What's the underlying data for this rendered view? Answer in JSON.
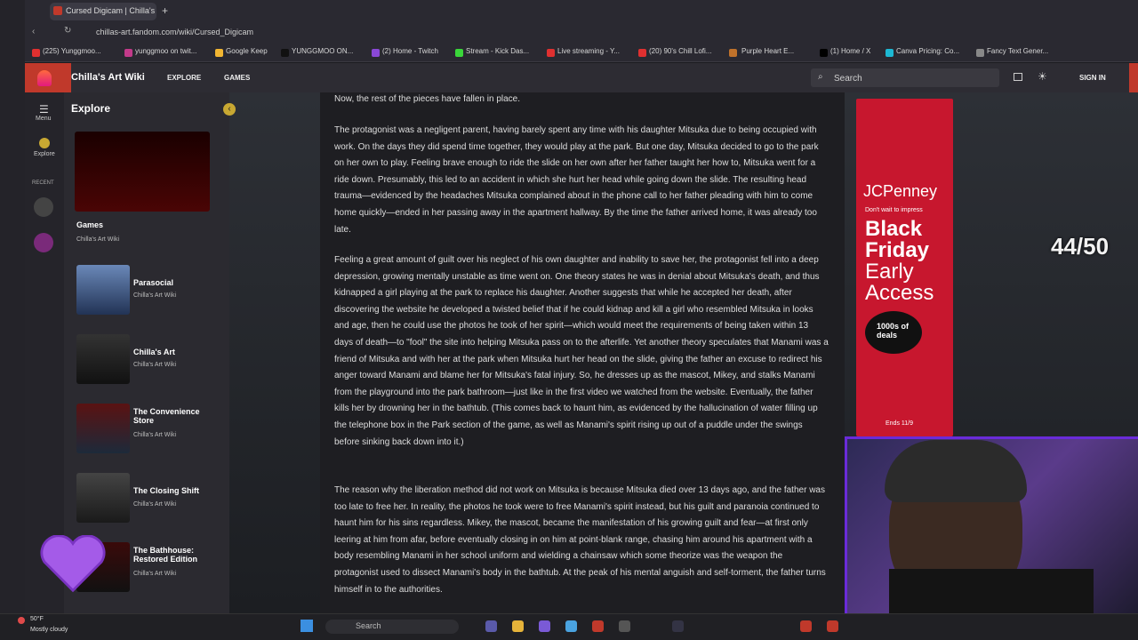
{
  "browser": {
    "tab_title": "Cursed Digicam | Chilla's",
    "url": "chillas-art.fandom.com/wiki/Cursed_Digicam",
    "bookmarks": [
      "(225) Yunggmoo...",
      "yunggmoo on twit...",
      "Google Keep",
      "YUNGGMOO ON...",
      "(2) Home - Twitch",
      "Stream - Kick Das...",
      "Live streaming - Y...",
      "(20) 90's Chill Lofi...",
      "Purple Heart E...",
      "(1) Home / X",
      "Canva Pricing: Co...",
      "Fancy Text Gener..."
    ]
  },
  "header": {
    "wiki_name": "Chilla's Art Wiki",
    "nav": [
      "EXPLORE",
      "GAMES"
    ],
    "search_label": "Search",
    "sign_in": "SIGN IN"
  },
  "rail": {
    "menu": "Menu",
    "explore": "Explore",
    "recent": "RECENT"
  },
  "explore": {
    "title": "Explore",
    "cards": [
      {
        "title": "Games",
        "sub": "Chilla's Art Wiki"
      },
      {
        "title": "Parasocial",
        "sub": "Chilla's Art Wiki"
      },
      {
        "title": "Chilla's Art",
        "sub": "Chilla's Art Wiki"
      },
      {
        "title": "The Convenience Store",
        "sub": "Chilla's Art Wiki"
      },
      {
        "title": "The Closing Shift",
        "sub": "Chilla's Art Wiki"
      },
      {
        "title": "The Bathhouse: Restored Edition",
        "sub": "Chilla's Art Wiki"
      }
    ]
  },
  "article": {
    "p0": "Now, the rest of the pieces have fallen in place.",
    "p1": "The protagonist was a negligent parent, having barely spent any time with his daughter Mitsuka due to being occupied with work. On the days they did spend time together, they would play at the park. But one day, Mitsuka decided to go to the park on her own to play. Feeling brave enough to ride the slide on her own after her father taught her how to, Mitsuka went for a ride down. Presumably, this led to an accident in which she hurt her head while going down the slide. The resulting head trauma—evidenced by the headaches Mitsuka complained about in the phone call to her father pleading with him to come home quickly—ended in her passing away in the apartment hallway. By the time the father arrived home, it was already too late.",
    "p2": "Feeling a great amount of guilt over his neglect of his own daughter and inability to save her, the protagonist fell into a deep depression, growing mentally unstable as time went on. One theory states he was in denial about Mitsuka's death, and thus kidnapped a girl playing at the park to replace his daughter. Another suggests that while he accepted her death, after discovering the website he developed a twisted belief that if he could kidnap and kill a girl who resembled Mitsuka in looks and age, then he could use the photos he took of her spirit—which would meet the requirements of being taken within 13 days of death—to \"fool\" the site into helping Mitsuka pass on to the afterlife. Yet another theory speculates that Manami was a friend of Mitsuka and with her at the park when Mitsuka hurt her head on the slide, giving the father an excuse to redirect his anger toward Manami and blame her for Mitsuka's fatal injury. So, he dresses up as the mascot, Mikey, and stalks Manami from the playground into the park bathroom—just like in the first video we watched from the website. Eventually, the father kills her by drowning her in the bathtub. (This comes back to haunt him, as evidenced by the hallucination of water filling up the telephone box in the Park section of the game, as well as Manami's spirit rising up out of a puddle under the swings before sinking back down into it.)",
    "p3": "The reason why the liberation method did not work on Mitsuka is because Mitsuka died over 13 days ago, and the father was too late to free her. In reality, the photos he took were to free Manami's spirit instead, but his guilt and paranoia continued to haunt him for his sins regardless. Mikey, the mascot, became the manifestation of his growing guilt and fear—at first only leering at him from afar, before eventually closing in on him at point-blank range, chasing him around his apartment with a body resembling Manami in her school uniform and wielding a chainsaw which some theorize was the weapon the protagonist used to dissect Manami's body in the bathtub. At the peak of his mental anguish and self-torment, the father turns himself in to the authorities."
  },
  "ad": {
    "brand": "JCPenney",
    "tagline": "Don't wait to impress",
    "line1": "Black",
    "line2": "Friday",
    "line3": "Early",
    "line4": "Access",
    "seal": "1000s of deals",
    "ends": "Ends 11/9"
  },
  "overlay": {
    "counter": "44/50"
  },
  "taskbar": {
    "temp": "50°F",
    "weather": "Mostly cloudy",
    "search": "Search"
  }
}
